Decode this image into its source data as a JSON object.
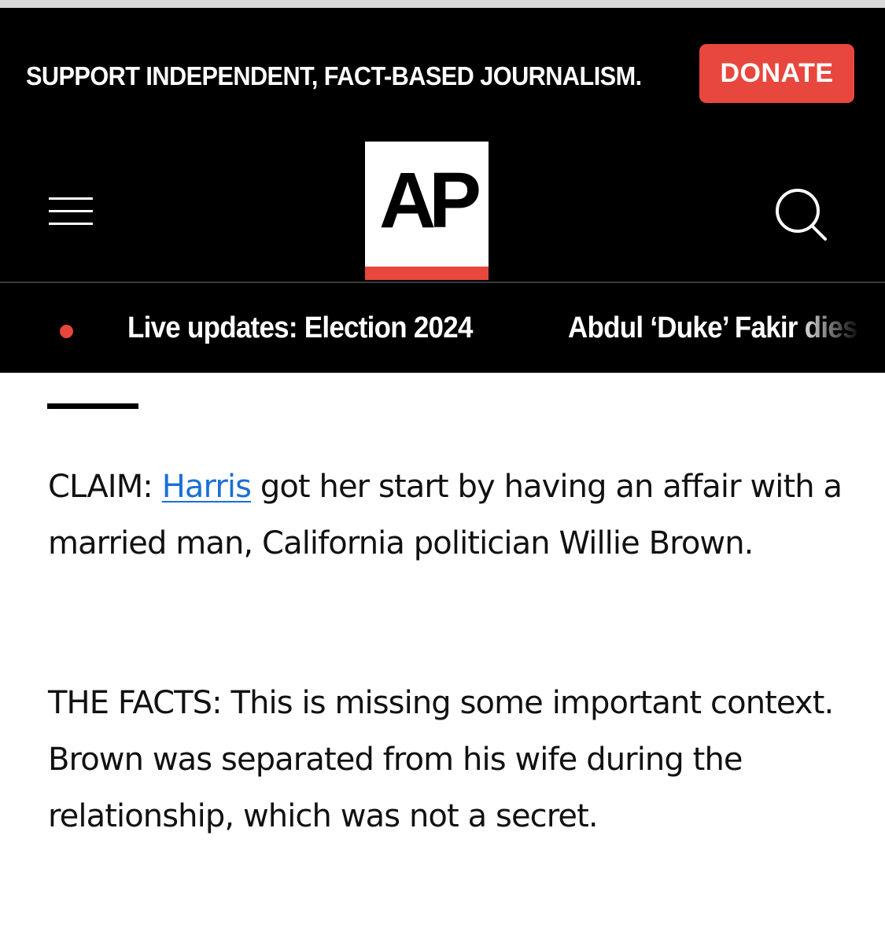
{
  "support_banner": {
    "message": "SUPPORT INDEPENDENT, FACT-BASED JOURNALISM.",
    "donate_label": "DONATE"
  },
  "header": {
    "logo_text": "AP",
    "menu_icon": "hamburger-menu-icon",
    "search_icon": "search-icon"
  },
  "ticker": {
    "live_indicator_color": "#e8473d",
    "items": [
      "Live updates: Election 2024",
      "Abdul ‘Duke’ Fakir dies"
    ]
  },
  "article": {
    "claim": {
      "prefix": "CLAIM: ",
      "link_text": "Harris",
      "rest": " got her start by having an affair with a married man, California politician Willie Brown."
    },
    "facts": {
      "text": "THE FACTS: This is missing some important context. Brown was separated from his wife during the relationship, which was not a secret."
    }
  },
  "colors": {
    "accent_red": "#e8473d",
    "header_bg": "#000000",
    "link_blue": "#1a6fd6"
  }
}
